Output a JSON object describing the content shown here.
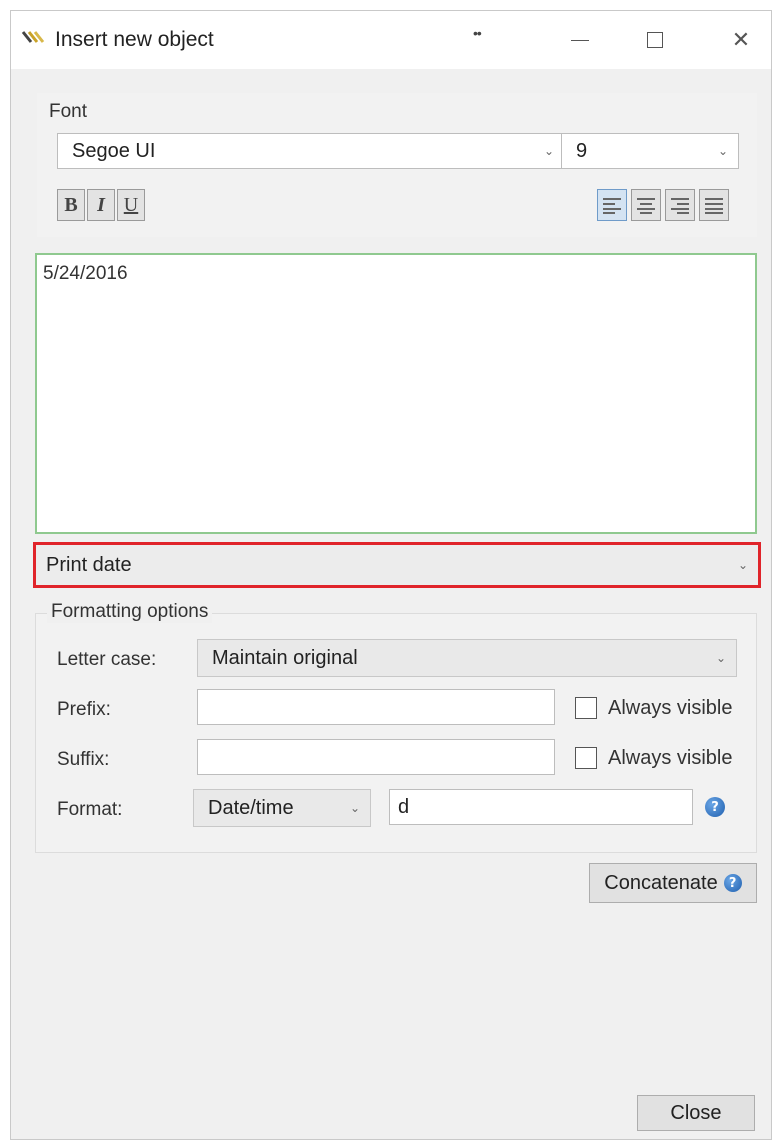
{
  "window": {
    "title": "Insert new object",
    "grip": "••",
    "minimize_icon": "minimize-icon",
    "maximize_icon": "maximize-icon",
    "close_glyph": "✕"
  },
  "font": {
    "label": "Font",
    "family_value": "Segoe UI",
    "size_value": "9",
    "bold_label": "B",
    "italic_label": "I",
    "underline_label": "U",
    "alignments": [
      "align-left",
      "align-center",
      "align-right",
      "align-justify"
    ],
    "active_alignment": "align-left"
  },
  "preview": {
    "text": "5/24/2016"
  },
  "field": {
    "selected": "Print date"
  },
  "formatting": {
    "legend": "Formatting options",
    "letter_case_label": "Letter case:",
    "letter_case_value": "Maintain original",
    "prefix_label": "Prefix:",
    "prefix_value": "",
    "suffix_label": "Suffix:",
    "suffix_value": "",
    "always_visible_label": "Always visible",
    "format_label": "Format:",
    "format_type_value": "Date/time",
    "format_string_value": "d",
    "help_glyph": "?"
  },
  "buttons": {
    "concatenate": "Concatenate",
    "close": "Close"
  },
  "colors": {
    "highlight_border": "#e0242a",
    "preview_border": "#8fc98f",
    "help_blue": "#1f5fae"
  }
}
